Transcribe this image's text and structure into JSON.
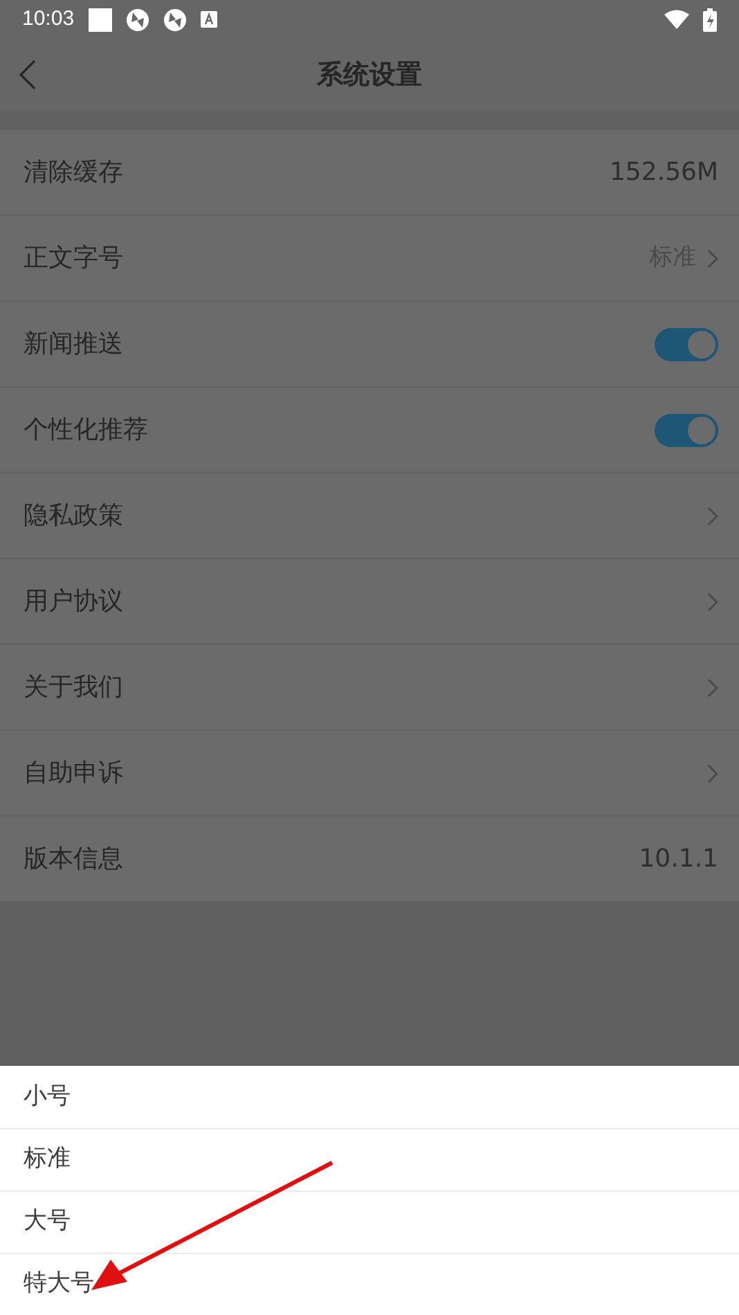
{
  "status_bar": {
    "time": "10:03"
  },
  "header": {
    "title": "系统设置"
  },
  "settings": [
    {
      "kind": "value",
      "label": "清除缓存",
      "value": "152.56M"
    },
    {
      "kind": "select",
      "label": "正文字号",
      "value": "标准"
    },
    {
      "kind": "toggle",
      "label": "新闻推送",
      "on": true
    },
    {
      "kind": "toggle",
      "label": "个性化推荐",
      "on": true
    },
    {
      "kind": "link",
      "label": "隐私政策"
    },
    {
      "kind": "link",
      "label": "用户协议"
    },
    {
      "kind": "link",
      "label": "关于我们"
    },
    {
      "kind": "link",
      "label": "自助申诉"
    },
    {
      "kind": "value",
      "label": "版本信息",
      "value": "10.1.1"
    }
  ],
  "font_size_sheet": {
    "options": [
      "小号",
      "标准",
      "大号",
      "特大号"
    ]
  }
}
